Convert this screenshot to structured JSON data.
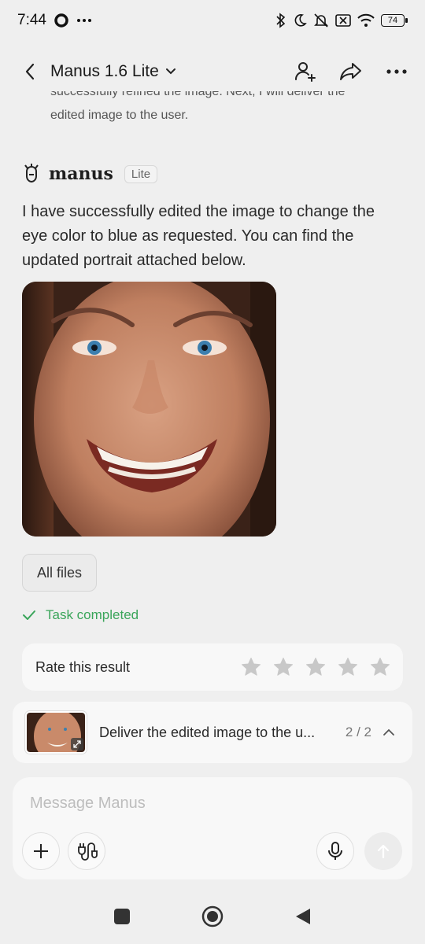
{
  "status": {
    "time": "7:44",
    "battery": "74",
    "icons": [
      "record-icon",
      "more-dots-icon",
      "bluetooth-icon",
      "moon-icon",
      "mute-icon",
      "sim-icon",
      "wifi-icon",
      "battery-icon"
    ]
  },
  "header": {
    "title": "Manus 1.6 Lite",
    "icons": [
      "back-icon",
      "chevron-down-icon",
      "add-user-icon",
      "share-icon",
      "more-icon"
    ]
  },
  "chat": {
    "clipped_line_1": "successfully refined the image. Next, I will deliver the",
    "clipped_line_2": "edited image to the user.",
    "agent_name": "manus",
    "agent_badge": "Lite",
    "message": "I have successfully edited the image to change the eye color to blue as requested. You can find the updated portrait attached below.",
    "files_button": "All files",
    "task_status": "Task completed"
  },
  "rating": {
    "label": "Rate this result",
    "stars": 5,
    "selected": 0
  },
  "task": {
    "title": "Deliver the edited image to the u...",
    "count": "2 / 2"
  },
  "composer": {
    "placeholder": "Message Manus"
  },
  "colors": {
    "background": "#efefef",
    "card": "#f8f8f8",
    "success": "#3aa55a",
    "star": "#c8c8c8"
  }
}
